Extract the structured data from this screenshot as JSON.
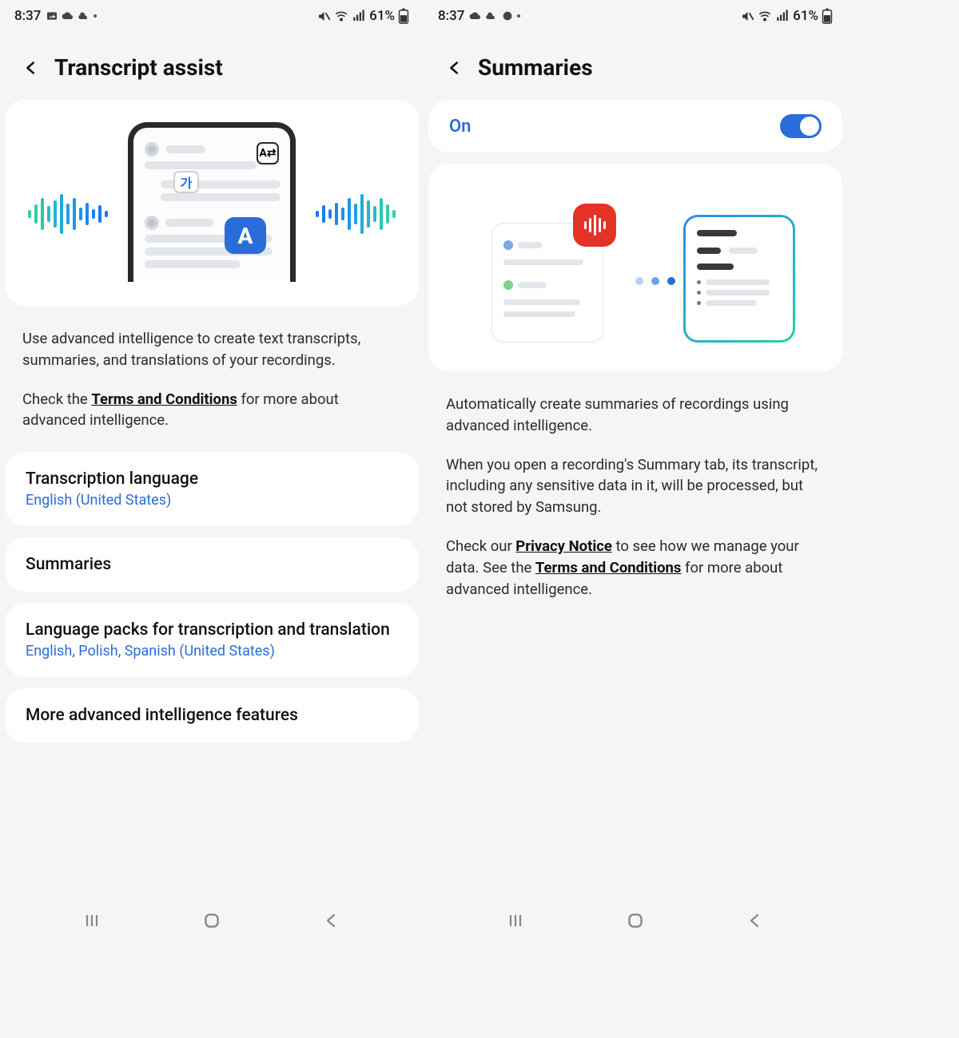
{
  "statusbar": {
    "time": "8:37",
    "battery_text": "61%"
  },
  "left": {
    "title": "Transcript assist",
    "desc1": "Use advanced intelligence to create text transcripts, summaries, and translations of your recordings.",
    "desc2_pre": "Check the ",
    "desc2_link": "Terms and Conditions",
    "desc2_post": " for more about advanced intelligence.",
    "items": {
      "transcription_language": {
        "title": "Transcription language",
        "value": "English (United States)"
      },
      "summaries": {
        "title": "Summaries"
      },
      "language_packs": {
        "title": "Language packs for transcription and translation",
        "value": "English, Polish, Spanish (United States)"
      },
      "more_ai": {
        "title": "More advanced intelligence features"
      }
    },
    "illus": {
      "ko_glyph": "가",
      "a_glyph": "A"
    }
  },
  "right": {
    "title": "Summaries",
    "toggle_label": "On",
    "toggle_state": true,
    "desc1": "Automatically create summaries of recordings using advanced intelligence.",
    "desc2": "When you open a recording's Summary tab, its transcript, including any sensitive data in it, will be processed, but not stored by Samsung.",
    "desc3_pre": "Check our ",
    "desc3_link1": "Privacy Notice",
    "desc3_mid": " to see how we manage your data. See the ",
    "desc3_link2": "Terms and Conditions",
    "desc3_post": " for more about advanced intelligence."
  }
}
